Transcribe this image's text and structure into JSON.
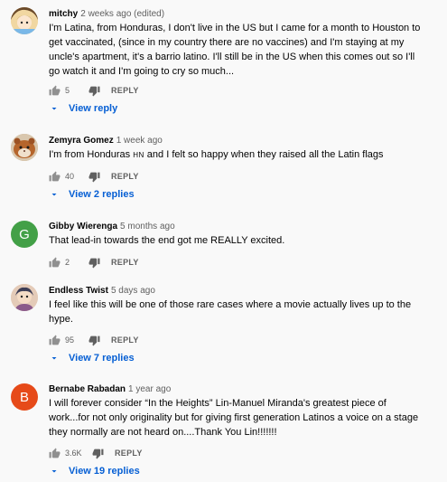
{
  "comments": [
    {
      "author": "mitchy",
      "meta": "2 weeks ago (edited)",
      "text": "I'm Latina, from Honduras, I don't live in the US but I came for a month to Houston to get vaccinated, (since in my country there are no vaccines) and I'm staying at my uncle's apartment, it's a barrio latino. I'll still be in the US when this comes out so I'll go watch it and I'm going to cry so much...",
      "likes": "5",
      "reply_label": "REPLY",
      "view_replies": "View reply",
      "avatar_icon": "anime-avatar"
    },
    {
      "author": "Zemyra Gomez",
      "meta": "1 week ago",
      "text_before": "I'm from Honduras ",
      "flag": "HN",
      "text_after": " and I felt so happy when they raised all the Latin flags",
      "likes": "40",
      "reply_label": "REPLY",
      "view_replies": "View 2 replies",
      "avatar_icon": "hamster-avatar"
    },
    {
      "author": "Gibby Wierenga",
      "meta": "5 months ago",
      "text": "That lead-in towards the end got me REALLY excited.",
      "likes": "2",
      "reply_label": "REPLY",
      "avatar_letter": "G",
      "avatar_color": "#43a047"
    },
    {
      "author": "Endless Twist",
      "meta": "5 days ago",
      "text": "I feel like this will be one of those rare cases where a movie actually lives up to the hype.",
      "likes": "95",
      "reply_label": "REPLY",
      "view_replies": "View 7 replies",
      "avatar_icon": "character-avatar"
    },
    {
      "author": "Bernabe Rabadan",
      "meta": "1 year ago",
      "text": "I will forever consider “In the Heights” Lin-Manuel Miranda's greatest piece of work...for not only originality but for giving first generation Latinos a voice on a stage they normally are not heard on....Thank You Lin!!!!!!!",
      "likes": "3.6K",
      "reply_label": "REPLY",
      "view_replies": "View 19 replies",
      "avatar_letter": "B",
      "avatar_color": "#e64a19"
    }
  ],
  "icons": {
    "like": "thumbs-up-icon",
    "dislike": "thumbs-down-icon",
    "expand": "chevron-down-icon"
  },
  "colors": {
    "background": "#f9f9f9",
    "link": "#065fd4",
    "meta": "#606060",
    "icon": "#909090"
  }
}
